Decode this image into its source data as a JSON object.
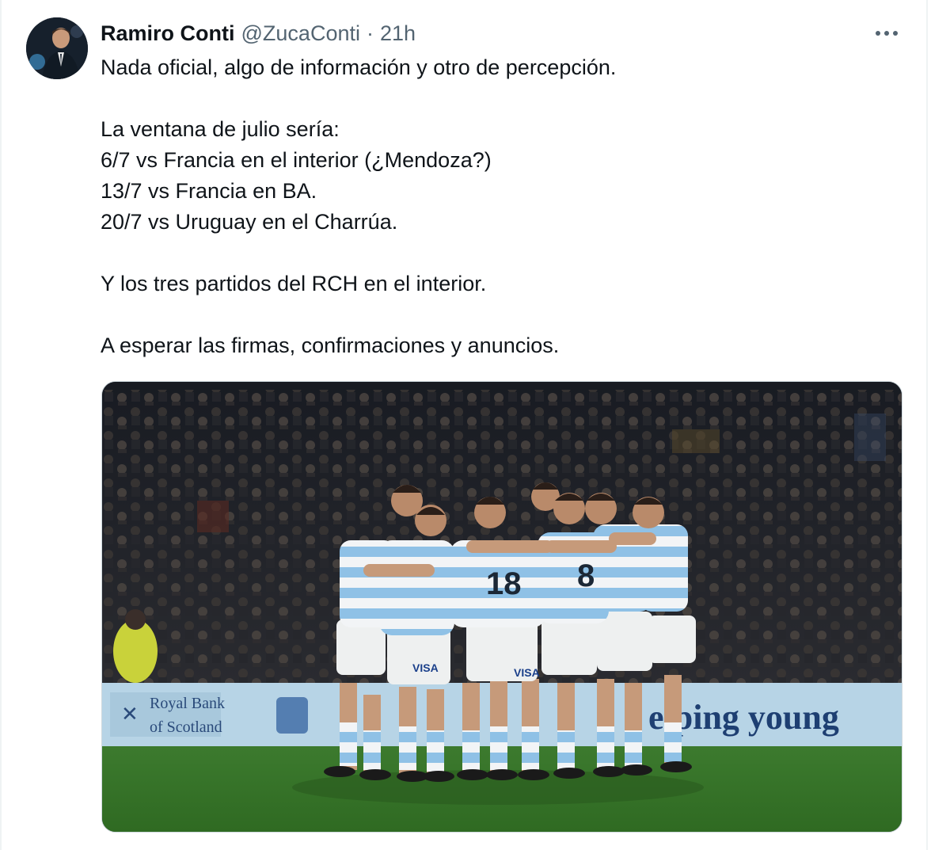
{
  "tweet": {
    "author_name": "Ramiro Conti",
    "author_handle": "@ZucaConti",
    "separator": "·",
    "time": "21h",
    "lines": [
      "Nada oficial, algo de información y otro de percepción.",
      "",
      "La ventana de julio sería:",
      "6/7 vs Francia en el interior (¿Mendoza?)",
      "13/7 vs Francia en BA.",
      "20/7 vs Uruguay en el Charrúa.",
      "",
      "Y los tres partidos del RCH en el interior.",
      "",
      "A esperar las firmas, confirmaciones y anuncios."
    ]
  },
  "media": {
    "banner_left_text_1": "Royal Bank",
    "banner_left_text_2": "of Scotland",
    "banner_right_text": "elping young",
    "jersey_numbers": [
      "18",
      "8"
    ],
    "sponsor": "VISA"
  },
  "icons": {
    "more": "more-horizontal-icon",
    "avatar": "avatar-photo"
  },
  "colors": {
    "text_primary": "#0f1419",
    "text_secondary": "#536471",
    "border": "#cfd9de",
    "jersey_blue": "#8fc1e6"
  }
}
